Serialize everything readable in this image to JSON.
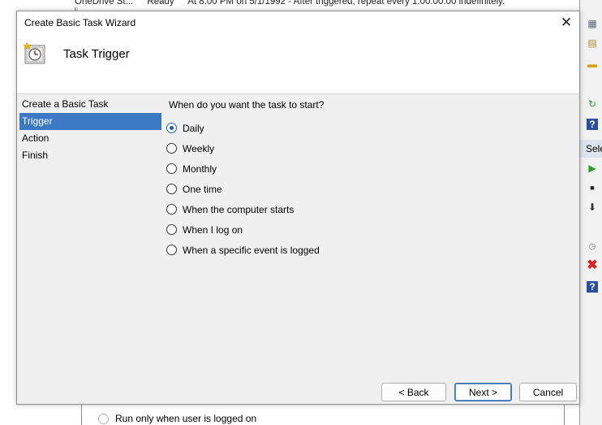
{
  "background": {
    "top_row": [
      "OneDrive St...",
      "Ready",
      "At 8:00 PM on 5/1/1992 - After triggered, repeat every 1.00:00:00 indefinitely."
    ],
    "right_panel_selected": "Sele",
    "bottom_option": "Run only when user is logged on"
  },
  "dialog": {
    "title": "Create Basic Task Wizard",
    "close_glyph": "✕",
    "header_title": "Task Trigger",
    "steps": [
      {
        "label": "Create a Basic Task",
        "active": false
      },
      {
        "label": "Trigger",
        "active": true
      },
      {
        "label": "Action",
        "active": false
      },
      {
        "label": "Finish",
        "active": false
      }
    ],
    "question": "When do you want the task to start?",
    "options": [
      {
        "label": "Daily",
        "checked": true
      },
      {
        "label": "Weekly",
        "checked": false
      },
      {
        "label": "Monthly",
        "checked": false
      },
      {
        "label": "One time",
        "checked": false
      },
      {
        "label": "When the computer starts",
        "checked": false
      },
      {
        "label": "When I log on",
        "checked": false
      },
      {
        "label": "When a specific event is logged",
        "checked": false
      }
    ],
    "buttons": {
      "back": "< Back",
      "next": "Next >",
      "cancel": "Cancel"
    }
  },
  "colors": {
    "selected_step": "#3c79c4",
    "dialog_bg": "#f0f0f0",
    "radio_checked": "#1a5fb4"
  }
}
